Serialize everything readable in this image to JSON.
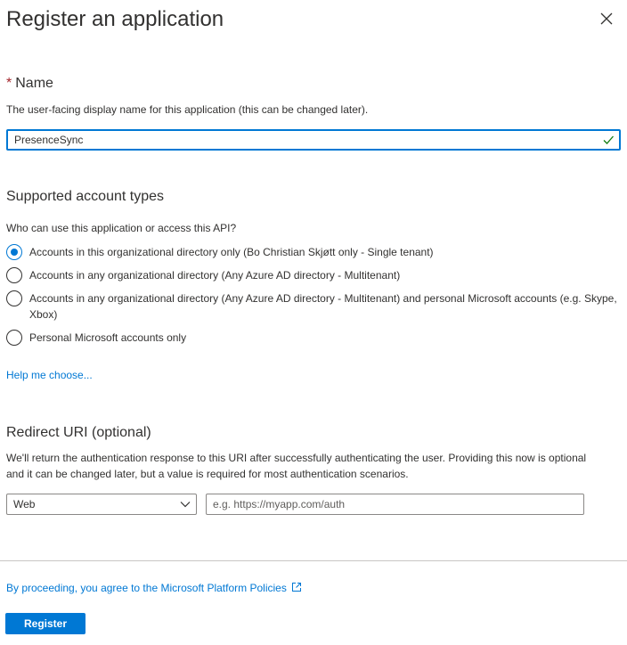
{
  "header": {
    "title": "Register an application",
    "close_icon": "close-icon"
  },
  "name_section": {
    "required_mark": "*",
    "label": "Name",
    "description": "The user-facing display name for this application (this can be changed later).",
    "value": "PresenceSync",
    "valid_icon": "checkmark-icon"
  },
  "account_types": {
    "heading": "Supported account types",
    "question": "Who can use this application or access this API?",
    "options": [
      {
        "label": "Accounts in this organizational directory only (Bo Christian Skjøtt only - Single tenant)",
        "selected": true
      },
      {
        "label": "Accounts in any organizational directory (Any Azure AD directory - Multitenant)",
        "selected": false
      },
      {
        "label": "Accounts in any organizational directory (Any Azure AD directory - Multitenant) and personal Microsoft accounts (e.g. Skype, Xbox)",
        "selected": false
      },
      {
        "label": "Personal Microsoft accounts only",
        "selected": false
      }
    ],
    "help_link": "Help me choose..."
  },
  "redirect": {
    "heading": "Redirect URI (optional)",
    "description": "We'll return the authentication response to this URI after successfully authenticating the user. Providing this now is optional and it can be changed later, but a value is required for most authentication scenarios.",
    "platform_selected": "Web",
    "uri_placeholder": "e.g. https://myapp.com/auth"
  },
  "footer": {
    "policy_text": "By proceeding, you agree to the Microsoft Platform Policies",
    "register_label": "Register"
  },
  "colors": {
    "accent": "#0078d4",
    "valid": "#107c10",
    "required": "#a4262c"
  }
}
